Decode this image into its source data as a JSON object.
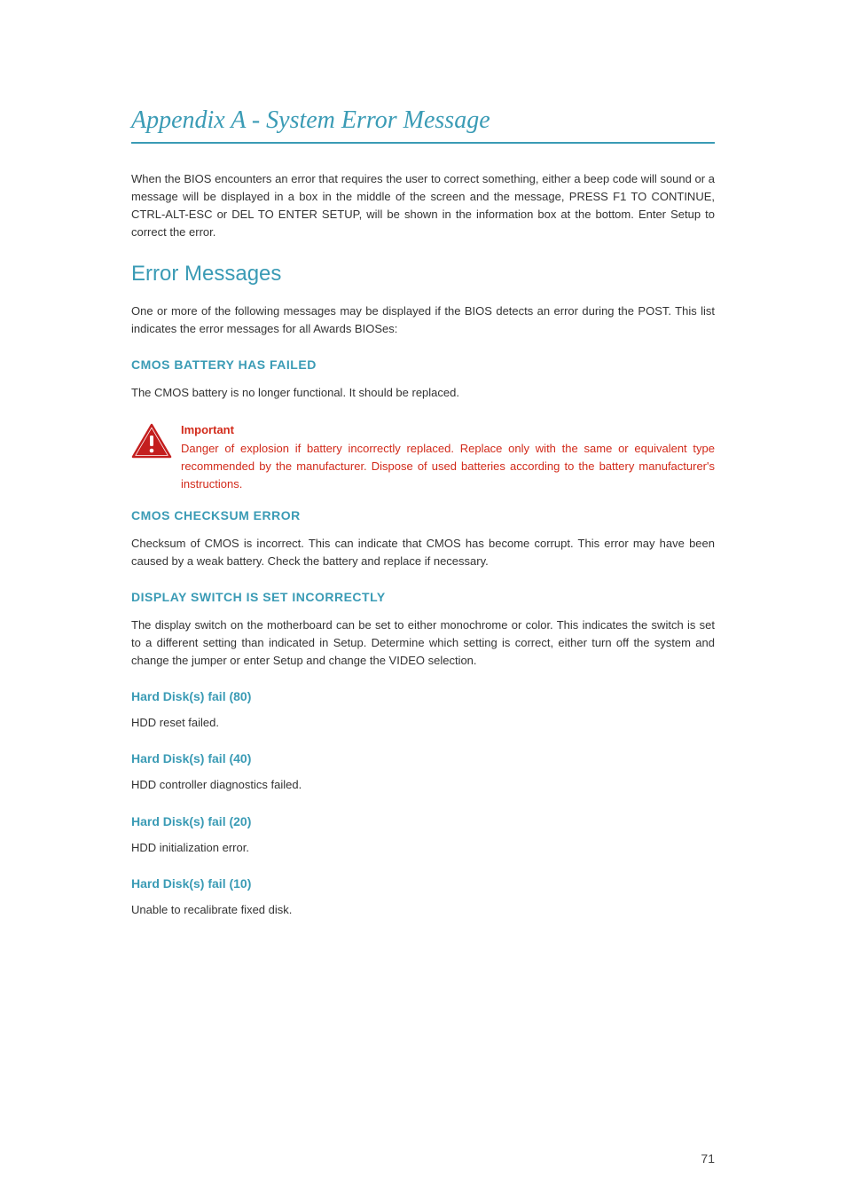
{
  "pageTitle": "Appendix A - System Error Message",
  "intro": "When the BIOS encounters an error that requires the user to correct something, either a beep code will sound or a message will be displayed in a box in the middle of the screen and the message, PRESS F1 TO CONTINUE, CTRL-ALT-ESC or DEL TO ENTER SETUP, will be shown in the information box at the bottom. Enter Setup to correct the error.",
  "section": {
    "title": "Error Messages",
    "intro": "One or more of the following messages may be displayed if the BIOS detects an error during the POST. This list indicates the error messages for all Awards BIOSes:"
  },
  "cmosBattery": {
    "title": "CMOS BATTERY HAS FAILED",
    "body": "The CMOS battery is no longer functional. It should be replaced."
  },
  "important": {
    "label": "Important",
    "body": "Danger of explosion if battery incorrectly replaced. Replace only with the same or equivalent type recommended by the manufacturer. Dispose of used batteries according to the battery manufacturer's instructions."
  },
  "cmosChecksum": {
    "title": "CMOS CHECKSUM ERROR",
    "body": "Checksum of CMOS is incorrect. This can indicate that CMOS has become corrupt. This error may have been caused by a weak battery. Check the battery and replace if necessary."
  },
  "displaySwitch": {
    "title": "DISPLAY SWITCH IS SET INCORRECTLY",
    "body": "The display switch on the motherboard can be set to either monochrome or color. This indicates the switch is set to a different setting than indicated in Setup. Determine which setting is correct, either turn off the system and change the jumper or enter Setup and change the VIDEO selection."
  },
  "hdd80": {
    "title": "Hard Disk(s) fail (80)",
    "body": "HDD reset failed."
  },
  "hdd40": {
    "title": "Hard Disk(s) fail (40)",
    "body": "HDD controller diagnostics failed."
  },
  "hdd20": {
    "title": "Hard Disk(s) fail (20)",
    "body": "HDD initialization error."
  },
  "hdd10": {
    "title": "Hard Disk(s) fail (10)",
    "body": "Unable to recalibrate fixed disk."
  },
  "pageNumber": "71"
}
